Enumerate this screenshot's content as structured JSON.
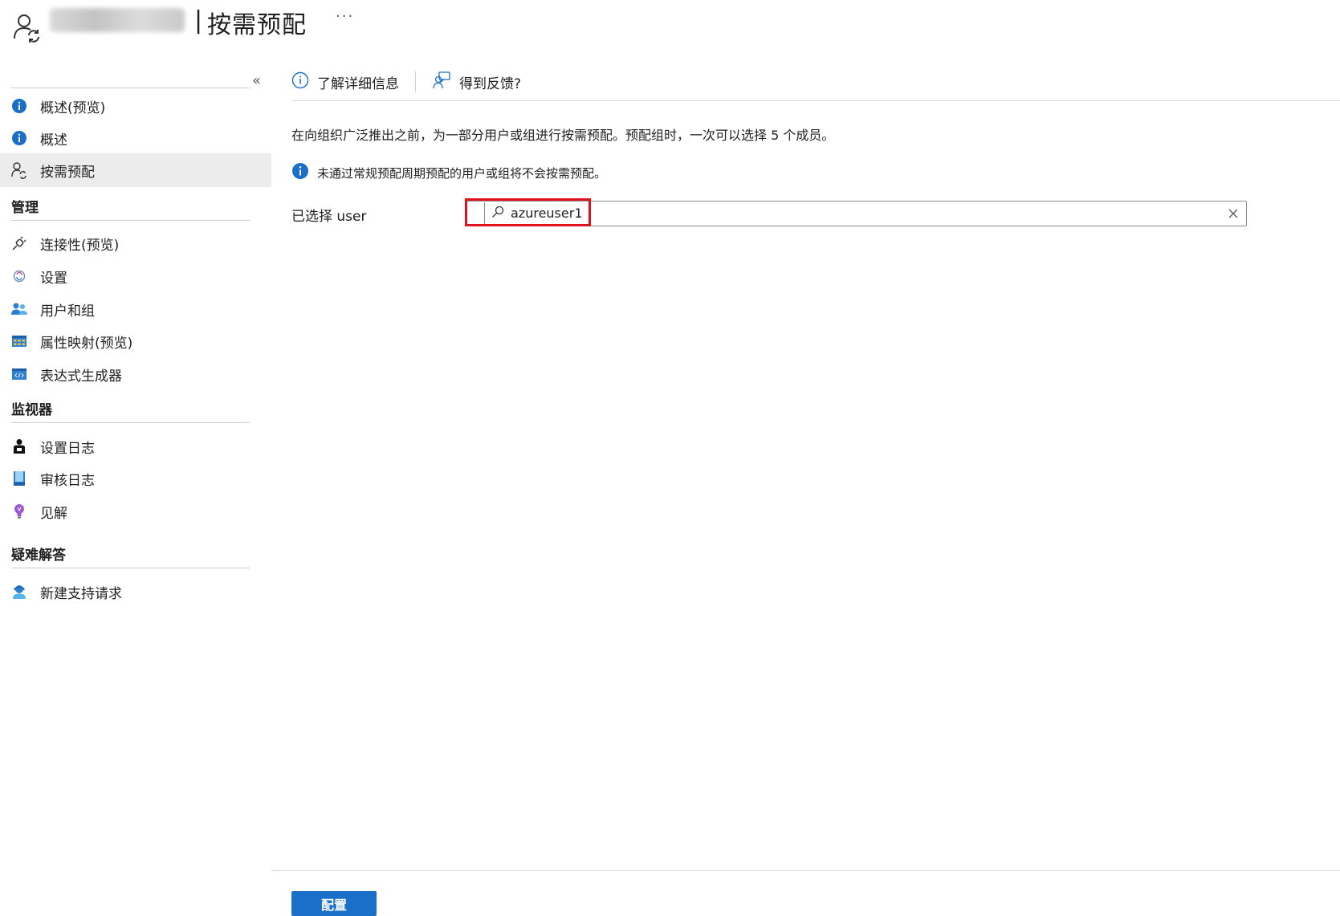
{
  "header": {
    "title_separator": "|",
    "title": "按需预配",
    "more_label": "···"
  },
  "sidebar": {
    "collapse_label": "«",
    "top_items": [
      {
        "label": "概述(预览)",
        "icon": "info-icon"
      },
      {
        "label": "概述",
        "icon": "info-icon"
      },
      {
        "label": "按需预配",
        "icon": "user-sync-icon",
        "active": true
      }
    ],
    "sections": [
      {
        "title": "管理",
        "items": [
          {
            "label": "连接性(预览)",
            "icon": "plug-icon"
          },
          {
            "label": "设置",
            "icon": "gear-icon"
          },
          {
            "label": "用户和组",
            "icon": "users-icon"
          },
          {
            "label": "属性映射(预览)",
            "icon": "table-icon"
          },
          {
            "label": "表达式生成器",
            "icon": "code-icon"
          }
        ]
      },
      {
        "title": "监视器",
        "items": [
          {
            "label": "设置日志",
            "icon": "person-log-icon"
          },
          {
            "label": "审核日志",
            "icon": "book-icon"
          },
          {
            "label": "见解",
            "icon": "lightbulb-icon"
          }
        ]
      },
      {
        "title": "疑难解答",
        "items": [
          {
            "label": "新建支持请求",
            "icon": "support-agent-icon"
          }
        ]
      }
    ]
  },
  "toolbar": {
    "learn_more_label": "了解详细信息",
    "feedback_label": "得到反馈?"
  },
  "main": {
    "description": "在向组织广泛推出之前，为一部分用户或组进行按需预配。预配组时，一次可以选择 5 个成员。",
    "info_text": "未通过常规预配周期预配的用户或组将不会按需预配。",
    "field_label": "已选择 user",
    "selected_value": "azureuser1",
    "primary_button": "配置"
  },
  "colors": {
    "accent": "#1a6fc9",
    "highlight": "#e0121e",
    "active_nav": "#ececec"
  }
}
